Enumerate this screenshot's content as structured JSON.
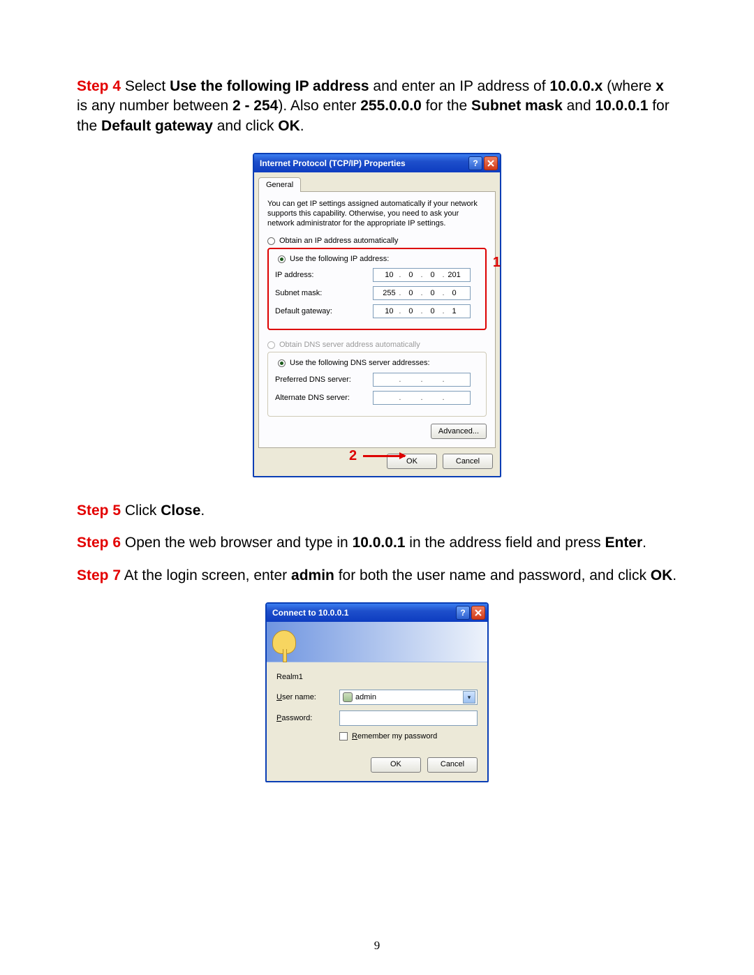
{
  "step4": {
    "label": "Step 4",
    "text_a": " Select ",
    "bold_a": "Use the following IP address",
    "text_b": " and enter an IP address of ",
    "bold_b": "10.0.0.x",
    "text_c": " (where ",
    "bold_c": "x",
    "text_d": " is any number between ",
    "bold_d": "2 - 254",
    "text_e": "). Also enter ",
    "bold_e": "255.0.0.0",
    "text_f": " for the ",
    "bold_f": "Subnet mask",
    "text_g": " and ",
    "bold_g": "10.0.0.1",
    "text_h": " for the ",
    "bold_h": "Default gateway",
    "text_i": " and click ",
    "bold_i": "OK",
    "text_j": "."
  },
  "step5": {
    "label": "Step 5",
    "text_a": " Click ",
    "bold_a": "Close",
    "text_b": "."
  },
  "step6": {
    "label": "Step 6",
    "text_a": " Open the web browser and type in ",
    "bold_a": "10.0.0.1",
    "text_b": " in the address field and press ",
    "bold_b": "Enter",
    "text_c": "."
  },
  "step7": {
    "label": "Step 7",
    "text_a": " At the login screen, enter ",
    "bold_a": "admin",
    "text_b": " for both the user name and password, and click ",
    "bold_b": "OK",
    "text_c": "."
  },
  "tcpip": {
    "title": "Internet Protocol (TCP/IP) Properties",
    "tab": "General",
    "hint": "You can get IP settings assigned automatically if your network supports this capability. Otherwise, you need to ask your network administrator for the appropriate IP settings.",
    "radio_auto_ip": "Obtain an IP address automatically",
    "radio_static_ip": "Use the following IP address:",
    "lbl_ip": "IP address:",
    "lbl_subnet": "Subnet mask:",
    "lbl_gateway": "Default gateway:",
    "ip": [
      "10",
      "0",
      "0",
      "201"
    ],
    "subnet": [
      "255",
      "0",
      "0",
      "0"
    ],
    "gateway": [
      "10",
      "0",
      "0",
      "1"
    ],
    "radio_auto_dns": "Obtain DNS server address automatically",
    "radio_static_dns": "Use the following DNS server addresses:",
    "lbl_pref_dns": "Preferred DNS server:",
    "lbl_alt_dns": "Alternate DNS server:",
    "btn_adv": "Advanced...",
    "btn_ok": "OK",
    "btn_cancel": "Cancel",
    "annot1": "1",
    "annot2": "2"
  },
  "auth": {
    "title": "Connect to 10.0.0.1",
    "realm": "Realm1",
    "lbl_user_pre": "U",
    "lbl_user_post": "ser name:",
    "lbl_pass_pre": "P",
    "lbl_pass_post": "assword:",
    "user_value": "admin",
    "chk_pre": "R",
    "chk_post": "emember my password",
    "btn_ok": "OK",
    "btn_cancel": "Cancel"
  },
  "page_number": "9"
}
